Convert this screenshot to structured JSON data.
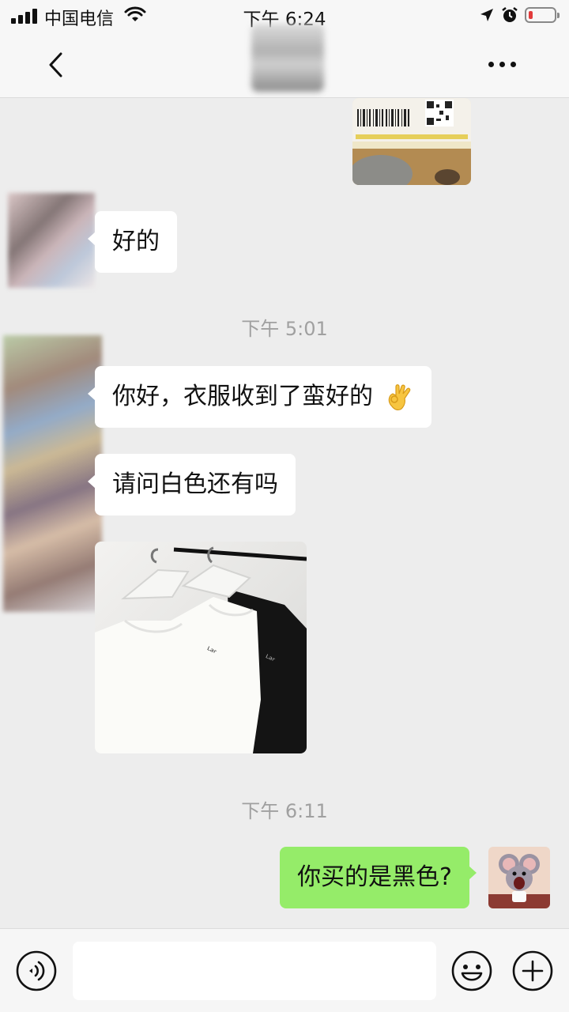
{
  "status_bar": {
    "carrier": "中国电信",
    "time": "下午 6:24",
    "icons": [
      "signal-icon",
      "wifi-icon",
      "location-icon",
      "alarm-icon",
      "battery-icon"
    ],
    "battery_level": 0.1
  },
  "nav": {
    "back_icon": "chevron-left-icon",
    "more_icon": "more-dots-icon"
  },
  "messages": {
    "m1": "好的",
    "ts1": "下午 5:01",
    "m2": "你好，衣服收到了蛮好的",
    "m3": "请问白色还有吗",
    "ts2": "下午 6:11",
    "m4": "你买的是黑色?"
  },
  "input_bar": {
    "value": "",
    "voice_icon": "voice-icon",
    "emoji_icon": "emoji-icon",
    "plus_icon": "plus-icon"
  },
  "colors": {
    "background": "#ededed",
    "outgoing_bubble": "#95ec69",
    "incoming_bubble": "#ffffff",
    "timestamp": "#a0a0a0"
  }
}
